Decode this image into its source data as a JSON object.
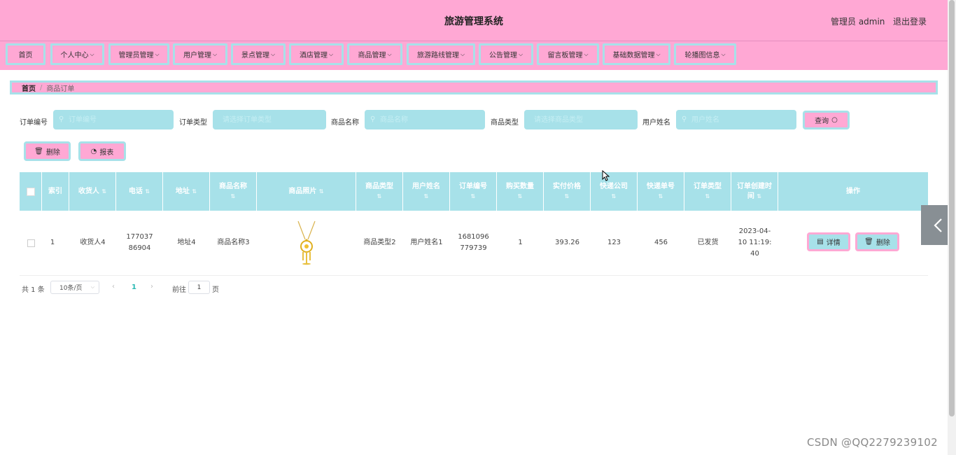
{
  "header": {
    "title": "旅游管理系统",
    "admin_label": "管理员 admin",
    "logout_label": "退出登录"
  },
  "colors": {
    "pink": "#ffa8d4",
    "cyan": "#a7e1e9",
    "active_page": "#2bb9b3"
  },
  "nav": {
    "items": [
      {
        "label": "首页"
      },
      {
        "label": "个人中心"
      },
      {
        "label": "管理员管理"
      },
      {
        "label": "用户管理"
      },
      {
        "label": "景点管理"
      },
      {
        "label": "酒店管理"
      },
      {
        "label": "商品管理"
      },
      {
        "label": "旅游路线管理"
      },
      {
        "label": "公告管理"
      },
      {
        "label": "留言板管理"
      },
      {
        "label": "基础数据管理"
      },
      {
        "label": "轮播图信息"
      }
    ]
  },
  "breadcrumb": {
    "home": "首页",
    "separator": "/",
    "current": "商品订单"
  },
  "search": {
    "fields": [
      {
        "label": "订单编号",
        "placeholder": "订单编号"
      },
      {
        "label": "订单类型",
        "placeholder": "请选择订单类型"
      },
      {
        "label": "商品名称",
        "placeholder": "商品名称"
      },
      {
        "label": "商品类型",
        "placeholder": "请选择商品类型"
      },
      {
        "label": "用户姓名",
        "placeholder": "用户姓名"
      }
    ],
    "query_label": "查询"
  },
  "actions": {
    "delete_label": "删除",
    "report_label": "报表"
  },
  "table": {
    "columns": [
      "",
      "索引",
      "收货人",
      "电话",
      "地址",
      "商品名称",
      "商品照片",
      "商品类型",
      "用户姓名",
      "订单编号",
      "购买数量",
      "实付价格",
      "快递公司",
      "快递单号",
      "订单类型",
      "订单创建时间",
      "操作"
    ],
    "rows": [
      {
        "index": "1",
        "receiver": "收货人4",
        "phone": "17703786904",
        "address": "地址4",
        "product_name": "商品名称3",
        "product_photo": "dreamcatcher-necklace-image",
        "product_type": "商品类型2",
        "user_name": "用户姓名1",
        "order_no": "1681096779739",
        "quantity": "1",
        "price": "393.26",
        "courier": "123",
        "tracking_no": "456",
        "order_type": "已发货",
        "created_at": "2023-04-10 11:19:40",
        "detail_label": "详情",
        "delete_label": "删除"
      }
    ]
  },
  "pagination": {
    "total": "共 1 条",
    "page_size": "10条/页",
    "current_page": "1",
    "goto_label": "前往",
    "goto_value": "1",
    "page_suffix": "页"
  },
  "watermark": "CSDN @QQ2279239102"
}
